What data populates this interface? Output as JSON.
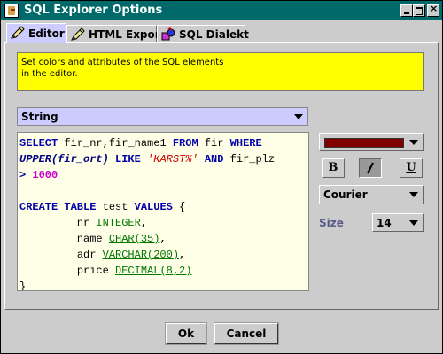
{
  "window": {
    "title": "SQL Explorer Options",
    "app_icon": "java-cup-icon",
    "title_color": "#006a6a",
    "controls": {
      "close_glyph": "×"
    }
  },
  "tabs": [
    {
      "label": "Editor",
      "icon": "pencil-icon",
      "active": true
    },
    {
      "label": "HTML Export",
      "icon": "pencil-icon",
      "active": false
    },
    {
      "label": "SQL Dialekt",
      "icon": "shapes-icon",
      "active": false
    }
  ],
  "info_box": {
    "line1": "Set colors and attributes of the SQL elements",
    "line2": "in the editor.",
    "background": "#ffff00"
  },
  "element_select": {
    "value": "String"
  },
  "code_preview": {
    "background": "#ffffe8",
    "tokens": {
      "select": "SELECT",
      "select_cols": " fir_nr,fir_name1 ",
      "from": "FROM",
      "table": " fir ",
      "where": "WHERE",
      "upper_fn": "UPPER(fir_ort)",
      "like": "LIKE",
      "like_pattern": "'KARST%'",
      "and": "AND",
      "plz_col": " fir_plz",
      "gt": "> ",
      "number": "1000",
      "create_table": "CREATE TABLE",
      "table_name": " test ",
      "values": "VALUES",
      "open_brace": " {",
      "col1": "nr",
      "type1": "INTEGER",
      "col2": "name",
      "type2": "CHAR(35)",
      "col3": "adr",
      "type3": "VARCHAR(200)",
      "col4": "price",
      "type4": "DECIMAL(8,2)",
      "comma": ",",
      "close_brace": "}"
    }
  },
  "color_select": {
    "value_color": "#800000"
  },
  "format_buttons": {
    "bold": {
      "label": "B",
      "pressed": false
    },
    "italic": {
      "label": "I",
      "pressed": true
    },
    "underline": {
      "label": "U",
      "pressed": false
    }
  },
  "font_select": {
    "value": "Courier"
  },
  "size": {
    "label": "Size",
    "value": "14"
  },
  "buttons": {
    "ok": "Ok",
    "cancel": "Cancel"
  }
}
